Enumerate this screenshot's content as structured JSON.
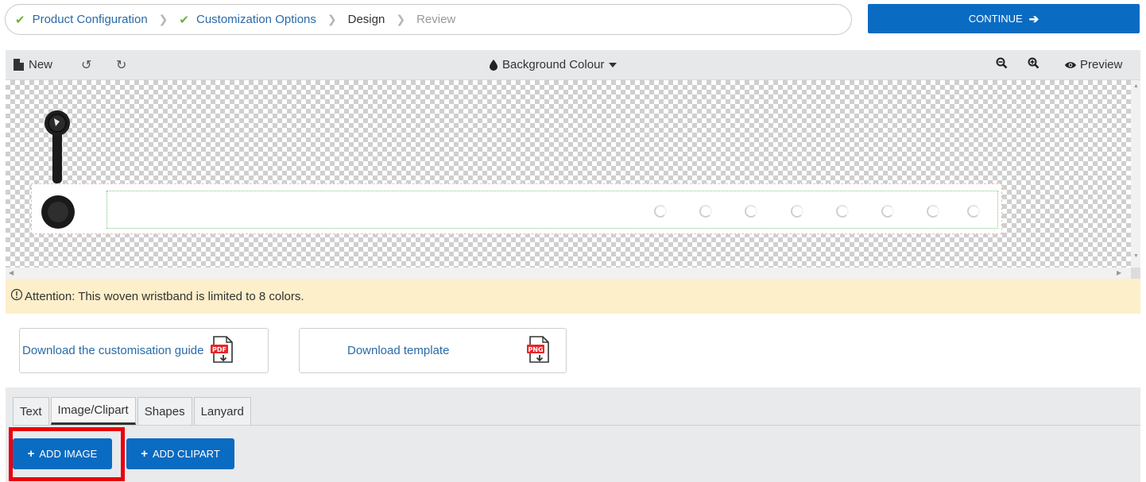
{
  "breadcrumb": {
    "steps": [
      {
        "label": "Product Configuration",
        "state": "done"
      },
      {
        "label": "Customization Options",
        "state": "done"
      },
      {
        "label": "Design",
        "state": "current"
      },
      {
        "label": "Review",
        "state": "pending"
      }
    ],
    "separator": ">",
    "check_icon": "✔"
  },
  "continue": {
    "label": "CONTINUE",
    "icon": "arrow-right-icon"
  },
  "toolbar": {
    "new_label": "New",
    "background_label": "Background Colour",
    "preview_label": "Preview"
  },
  "attention": {
    "text": "Attention: This woven wristband is limited to 8 colors."
  },
  "downloads": {
    "guide_label": "Download the customisation guide",
    "guide_file_type": "PDF",
    "template_label": "Download template",
    "template_file_type": "PNG"
  },
  "tabs": [
    {
      "label": "Text",
      "active": false
    },
    {
      "label": "Image/Clipart",
      "active": true
    },
    {
      "label": "Shapes",
      "active": false
    },
    {
      "label": "Lanyard",
      "active": false
    }
  ],
  "actions": {
    "add_image_label": "ADD IMAGE",
    "add_clipart_label": "ADD CLIPART"
  },
  "colors": {
    "primary": "#0a6bc2",
    "check_green": "#6cb33f",
    "link_blue": "#2a6aa8",
    "attention_bg": "#fcefca",
    "highlight_red": "#e8000e"
  }
}
